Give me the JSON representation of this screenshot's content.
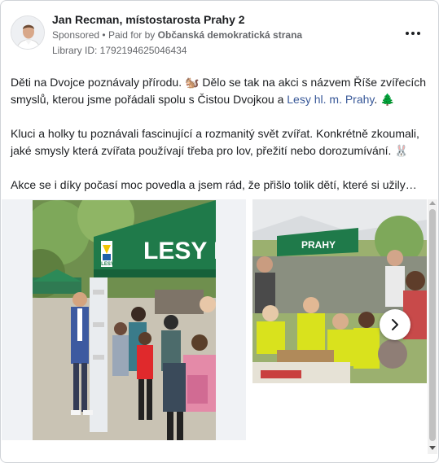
{
  "header": {
    "advertiser_name": "Jan Recman, místostarosta Prahy 2",
    "sponsored_label": "Sponsored",
    "separator": "•",
    "paid_for_label": "Paid for by",
    "payer_name": "Občanská demokratická strana",
    "library_id": "Library ID: 1792194625046434",
    "more_icon": "more-horizontal-icon"
  },
  "post": {
    "line1_text": "Děti na Dvojce poznávaly přírodu. ",
    "line1_emoji": "🐿️",
    "line1_rest": " Dělo se tak na akci s názvem Říše zvířecích smyslů, kterou jsme pořádali spolu s Čistou Dvojkou a ",
    "link_text": "Lesy hl. m. Prahy",
    "line1_end": ". ",
    "line1_emoji2": "🌲",
    "para2_text": "Kluci a holky tu poznávali fascinující a rozmanitý svět zvířat. Konkrétně zkoumali, jaké smysly která zvířata používají třeba pro lov, přežití nebo dorozumívání. ",
    "para2_emoji": "🐰",
    "para3_text": "Akce se i díky počasí moc povedla a jsem rád, že přišlo tolik dětí, které si užily…"
  },
  "media": {
    "banner1_text": "LESY H",
    "banner1_small": "LESY",
    "banner2_text": "PRAHY",
    "next_icon": "chevron-right-icon"
  },
  "colors": {
    "tent_green": "#1f7a4a",
    "link": "#385898",
    "secondary_text": "#65676b",
    "vest_yellow": "#d9e21d"
  }
}
